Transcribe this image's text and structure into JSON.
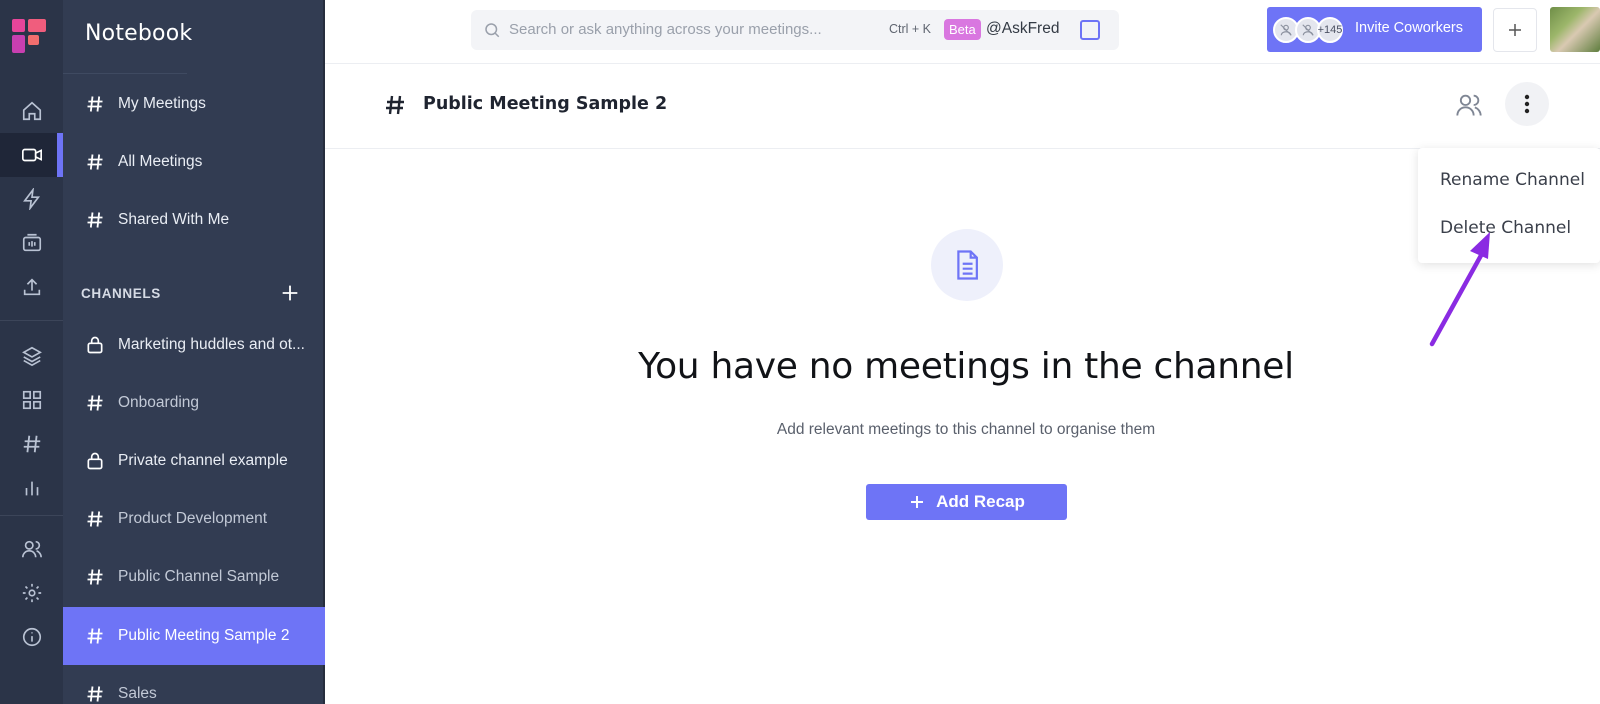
{
  "app": {
    "brand": "Notebook"
  },
  "rail": {
    "items": [
      "home-icon",
      "video-icon",
      "lightning-icon",
      "soundbite-icon",
      "upload-icon",
      "layers-icon",
      "apps-icon",
      "hash-icon",
      "chart-icon",
      "people-icon",
      "settings-icon",
      "info-icon"
    ],
    "active": "video-icon"
  },
  "sidebar": {
    "primary": [
      {
        "label": "My Meetings"
      },
      {
        "label": "All Meetings"
      },
      {
        "label": "Shared With Me"
      }
    ],
    "channels_title": "CHANNELS",
    "channels": [
      {
        "label": "Marketing huddles and ot...",
        "icon": "lock-icon"
      },
      {
        "label": "Onboarding",
        "icon": "hash-icon"
      },
      {
        "label": "Private channel example",
        "icon": "lock-icon"
      },
      {
        "label": "Product Development",
        "icon": "hash-icon"
      },
      {
        "label": "Public Channel Sample",
        "icon": "hash-icon"
      },
      {
        "label": "Public Meeting Sample 2",
        "icon": "hash-icon",
        "active": true
      },
      {
        "label": "Sales",
        "icon": "hash-icon"
      }
    ]
  },
  "topbar": {
    "search_placeholder": "Search or ask anything across your meetings...",
    "shortcut": "Ctrl + K",
    "beta_badge": "Beta",
    "ask_label": "@AskFred",
    "invite": {
      "count_badge": "+145",
      "label": "Invite Coworkers"
    }
  },
  "channel": {
    "title": "Public Meeting Sample 2"
  },
  "menu": {
    "rename": "Rename Channel",
    "delete": "Delete Channel"
  },
  "empty": {
    "title": "You have no meetings in the channel",
    "subtitle": "Add relevant meetings to this channel to organise them",
    "button": "Add Recap"
  },
  "colors": {
    "accent": "#6e74f6",
    "sidebar": "#323c52",
    "rail": "#2b3448",
    "annotation_arrow": "#8a2be2"
  }
}
